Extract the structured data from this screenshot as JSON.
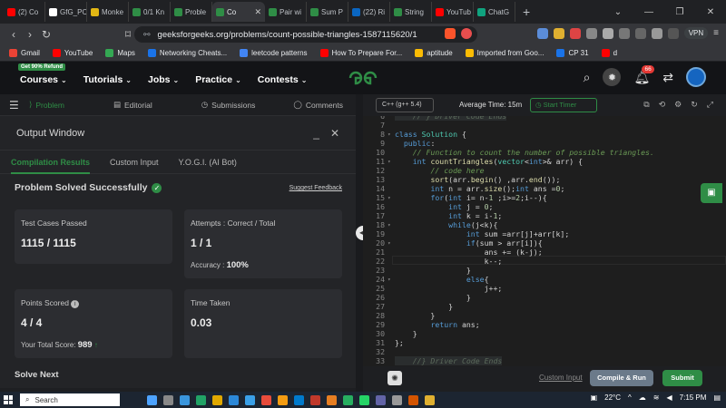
{
  "browser": {
    "tabs": [
      {
        "label": "(2) Co",
        "color": "#ff0000"
      },
      {
        "label": "GfG_PC",
        "color": "#ffffff"
      },
      {
        "label": "Monke",
        "color": "#e2b714"
      },
      {
        "label": "0/1 Kn",
        "color": "#2f8d46"
      },
      {
        "label": "Proble",
        "color": "#2f8d46"
      },
      {
        "label": "Co",
        "color": "#2f8d46",
        "active": true
      },
      {
        "label": "Pair wi",
        "color": "#2f8d46"
      },
      {
        "label": "Sum P",
        "color": "#2f8d46"
      },
      {
        "label": "(22) Ri",
        "color": "#0a66c2"
      },
      {
        "label": "String",
        "color": "#2f8d46"
      },
      {
        "label": "YouTub",
        "color": "#ff0000"
      },
      {
        "label": "ChatG",
        "color": "#10a37f"
      }
    ],
    "url": "geeksforgeeks.org/problems/count-possible-triangles-1587115620/1",
    "vpn_label": "VPN"
  },
  "bookmarks": [
    {
      "label": "Gmail",
      "color": "#ea4335"
    },
    {
      "label": "YouTube",
      "color": "#ff0000"
    },
    {
      "label": "Maps",
      "color": "#34a853"
    },
    {
      "label": "Networking Cheats...",
      "color": "#1a73e8"
    },
    {
      "label": "leetcode patterns",
      "color": "#4285f4"
    },
    {
      "label": "How To Prepare For...",
      "color": "#ff0000"
    },
    {
      "label": "aptitude",
      "color": "#fbbc04"
    },
    {
      "label": "Imported from Goo...",
      "color": "#fbbc04"
    },
    {
      "label": "CP 31",
      "color": "#1a73e8"
    },
    {
      "label": "d",
      "color": "#ff0000"
    }
  ],
  "header": {
    "refund_badge": "Get 90% Refund",
    "nav": [
      "Courses",
      "Tutorials",
      "Jobs",
      "Practice",
      "Contests"
    ],
    "notification_count": "66"
  },
  "problem_tabs": [
    "Problem",
    "Editorial",
    "Submissions",
    "Comments"
  ],
  "output": {
    "title": "Output Window",
    "tabs": [
      "Compilation Results",
      "Custom Input",
      "Y.O.G.I. (AI Bot)"
    ],
    "status": "Problem Solved Successfully",
    "suggest_feedback": "Suggest Feedback",
    "cards": {
      "test_cases_label": "Test Cases Passed",
      "test_cases_value": "1115 / 1115",
      "attempts_label": "Attempts : Correct / Total",
      "attempts_value": "1 / 1",
      "accuracy_label": "Accuracy :",
      "accuracy_value": "100%",
      "points_label": "Points Scored",
      "points_value": "4 / 4",
      "total_score_label": "Your Total Score:",
      "total_score_value": "989",
      "time_label": "Time Taken",
      "time_value": "0.03"
    },
    "solve_next": "Solve Next"
  },
  "editor": {
    "language": "C++ (g++ 5.4)",
    "avg_time": "Average Time: 15m",
    "timer": "Start Timer",
    "custom_input": "Custom Input",
    "compile_run": "Compile & Run",
    "submit": "Submit"
  },
  "taskbar": {
    "search": "Search",
    "temperature": "22°C",
    "time": "7:15 PM"
  }
}
